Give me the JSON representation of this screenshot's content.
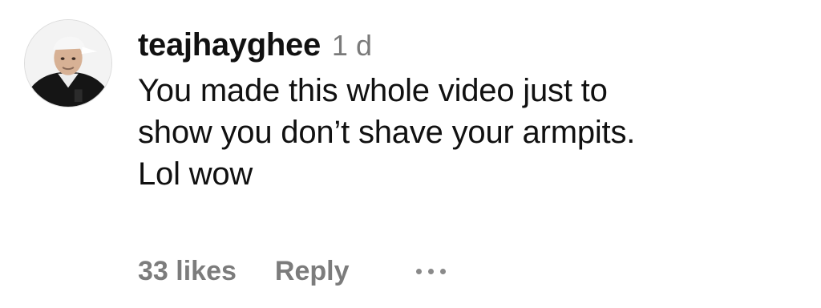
{
  "comment": {
    "avatar_icon": "user-avatar-photo",
    "username": "teajhayghee",
    "time": "1 d",
    "text": "You made this whole video just to\nshow you don’t shave your armpits.\nLol wow",
    "likes": "33 likes",
    "reply": "Reply",
    "more_icon": "more-options-icon"
  },
  "colors": {
    "primary_text": "#111111",
    "secondary_text": "#7a7a7a",
    "background": "#ffffff"
  }
}
